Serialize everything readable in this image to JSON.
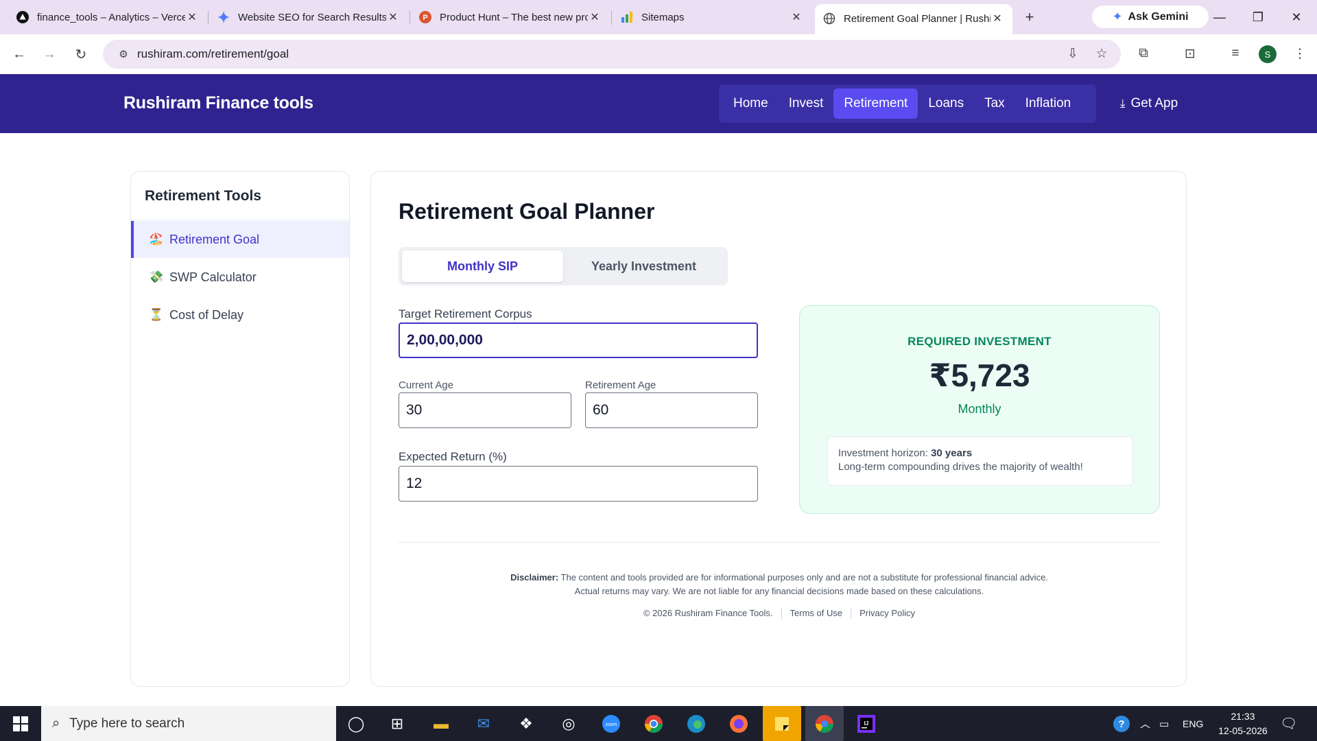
{
  "browser": {
    "tabs": [
      {
        "title": "finance_tools – Analytics – Vercel",
        "icon": "vercel-icon"
      },
      {
        "title": "Website SEO for Search Results",
        "icon": "gemini-icon"
      },
      {
        "title": "Product Hunt – The best new products",
        "icon": "product-hunt-icon"
      },
      {
        "title": "Sitemaps",
        "icon": "search-console-icon"
      },
      {
        "title": "Retirement Goal Planner | Rushiram",
        "icon": "globe-icon",
        "active": true
      }
    ],
    "new_tab": "+",
    "ask_gemini": "Ask Gemini",
    "url": "rushiram.com/retirement/goal",
    "profile_initial": "S"
  },
  "site": {
    "brand": "Rushiram Finance tools",
    "nav": [
      "Home",
      "Invest",
      "Retirement",
      "Loans",
      "Tax",
      "Inflation"
    ],
    "nav_active": "Retirement",
    "get_app": "Get App"
  },
  "sidebar": {
    "title": "Retirement Tools",
    "items": [
      {
        "label": "Retirement Goal",
        "emoji": "🏖️",
        "active": true
      },
      {
        "label": "SWP Calculator",
        "emoji": "💸",
        "active": false
      },
      {
        "label": "Cost of Delay",
        "emoji": "⏳",
        "active": false
      }
    ]
  },
  "planner": {
    "title": "Retirement Goal Planner",
    "modes": [
      "Monthly SIP",
      "Yearly Investment"
    ],
    "active_mode": "Monthly SIP",
    "corpus_label": "Target Retirement Corpus",
    "corpus_value": "2,00,00,000",
    "current_age_label": "Current Age",
    "current_age_value": "30",
    "retirement_age_label": "Retirement Age",
    "retirement_age_value": "60",
    "return_label": "Expected Return (%)",
    "return_value": "12"
  },
  "result": {
    "label": "REQUIRED INVESTMENT",
    "value": "₹5,723",
    "frequency": "Monthly",
    "horizon_prefix": "Investment horizon:",
    "horizon_value": "30 years",
    "horizon_note": "Long-term compounding drives the majority of wealth!"
  },
  "footer": {
    "disclaimer_label": "Disclaimer:",
    "disclaimer_text": "The content and tools provided are for informational purposes only and are not a substitute for professional financial advice.",
    "disclaimer_text_2": "Actual returns may vary. We are not liable for any financial decisions made based on these calculations.",
    "copyright": "© 2026 Rushiram Finance Tools.",
    "terms": "Terms of Use",
    "privacy": "Privacy Policy"
  },
  "taskbar": {
    "search_placeholder": "Type here to search",
    "language": "ENG",
    "time": "21:33",
    "date": "12-05-2026"
  },
  "colors": {
    "header_bg": "#2f238f",
    "nav_active_bg": "#5a4cf0",
    "accent": "#3f32c8",
    "result_bg": "#ecfdf5",
    "result_green": "#05875a"
  }
}
